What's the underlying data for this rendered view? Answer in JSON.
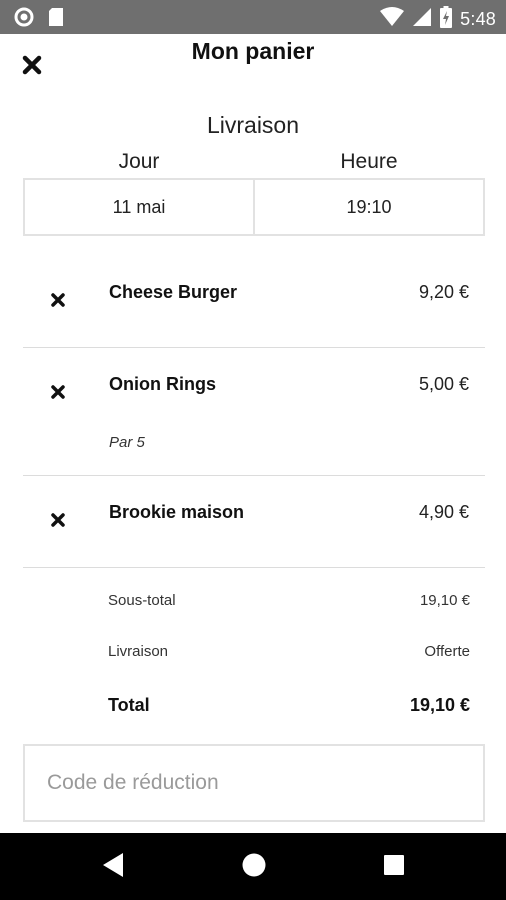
{
  "status_bar": {
    "time": "5:48",
    "icons": [
      "circle-notification-icon",
      "sd-card-icon",
      "wifi-icon",
      "signal-icon",
      "battery-charging-icon"
    ]
  },
  "header": {
    "title": "Mon panier",
    "close_icon": "close-icon"
  },
  "delivery": {
    "section_title": "Livraison",
    "day_label": "Jour",
    "hour_label": "Heure",
    "day_value": "11 mai",
    "hour_value": "19:10"
  },
  "items": [
    {
      "name": "Cheese Burger",
      "price": "9,20 €",
      "note": ""
    },
    {
      "name": "Onion Rings",
      "price": "5,00 €",
      "note": "Par 5"
    },
    {
      "name": "Brookie maison",
      "price": "4,90 €",
      "note": ""
    }
  ],
  "summary": {
    "subtotal_label": "Sous-total",
    "subtotal_value": "19,10 €",
    "delivery_label": "Livraison",
    "delivery_value": "Offerte",
    "total_label": "Total",
    "total_value": "19,10 €"
  },
  "promo": {
    "placeholder": "Code de réduction",
    "value": ""
  },
  "nav": {
    "icons": [
      "back-icon",
      "home-icon",
      "recent-apps-icon"
    ]
  }
}
